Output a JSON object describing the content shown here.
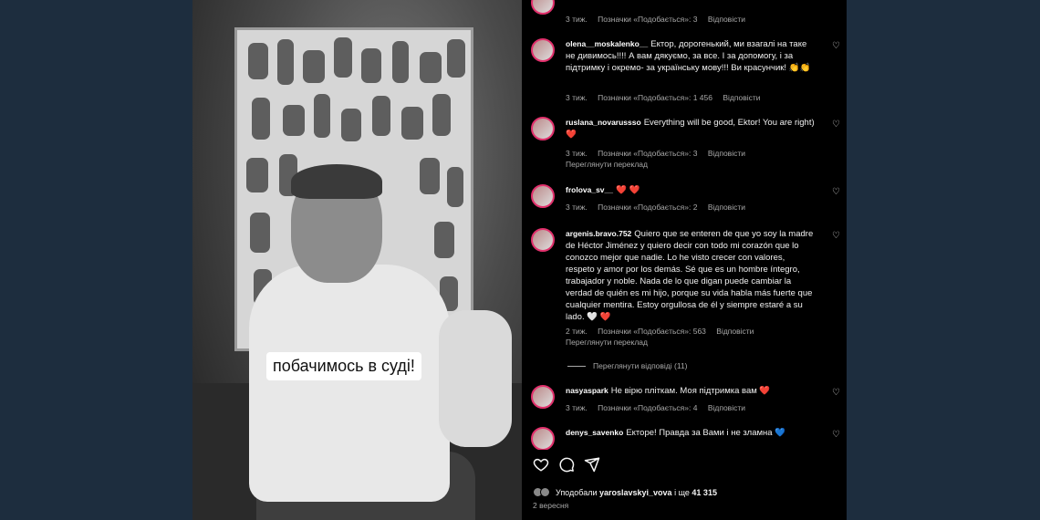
{
  "video": {
    "caption": "побачимось в суді!"
  },
  "comments": [
    {
      "user": "",
      "text": "",
      "meta": [
        "3 тиж.",
        "Позначки «Подобається»: 3",
        "Відповісти"
      ]
    },
    {
      "user": "olena__moskalenko__",
      "text": "Ектор, дорогенький, ми взагалі на таке не дивимось!!!! А вам дякуємо, за все. І за допомогу, і за підтримку і окремо- за українську мову!!! Ви красунчик! 👏👏",
      "meta": [
        "3 тиж.",
        "Позначки «Подобається»: 1 456",
        "Відповісти"
      ]
    },
    {
      "user": "ruslana_novarussso",
      "text": "Everything will be good, Ektor! You are right) ❤️",
      "meta": [
        "3 тиж.",
        "Позначки «Подобається»: 3",
        "Відповісти"
      ],
      "translate": "Переглянути переклад"
    },
    {
      "user": "frolova_sv__",
      "text": "❤️ ❤️",
      "meta": [
        "3 тиж.",
        "Позначки «Подобається»: 2",
        "Відповісти"
      ]
    },
    {
      "user": "argenis.bravo.752",
      "text": "Quiero que se enteren de que yo soy la madre de Héctor Jiménez y quiero decir con todo mi corazón que lo conozco mejor que nadie. Lo he visto crecer con valores, respeto y amor por los demás. Sé que es un hombre íntegro, trabajador y noble. Nada de lo que digan puede cambiar la verdad de quién es mi hijo, porque su vida habla más fuerte que cualquier mentira. Estoy orgullosa de él y siempre estaré a su lado. 🤍 ❤️",
      "meta": [
        "2 тиж.",
        "Позначки «Подобається»: 563",
        "Відповісти"
      ],
      "translate": "Переглянути переклад",
      "replies": "Переглянути відповіді (11)"
    },
    {
      "user": "nasyaspark",
      "text": "Не вірю пліткам. Моя підтримка вам ❤️",
      "meta": [
        "3 тиж.",
        "Позначки «Подобається»: 4",
        "Відповісти"
      ]
    },
    {
      "user": "denys_savenko",
      "text": "Екторе! Правда за Вами і не зламна 💙"
    }
  ],
  "footer": {
    "liked_prefix": "Уподобали",
    "liked_user": "yaroslavskyi_vova",
    "liked_suffix": "і ще",
    "liked_count": "41 315",
    "date": "2 вересня"
  },
  "icons": {
    "like": "heart-outline-icon",
    "comment": "comment-icon",
    "share": "send-icon"
  },
  "colors": {
    "page_bg": "#1d2d3e",
    "panel_bg": "#000000",
    "muted_text": "#a8a8a8",
    "story_ring": "#e1306c"
  }
}
